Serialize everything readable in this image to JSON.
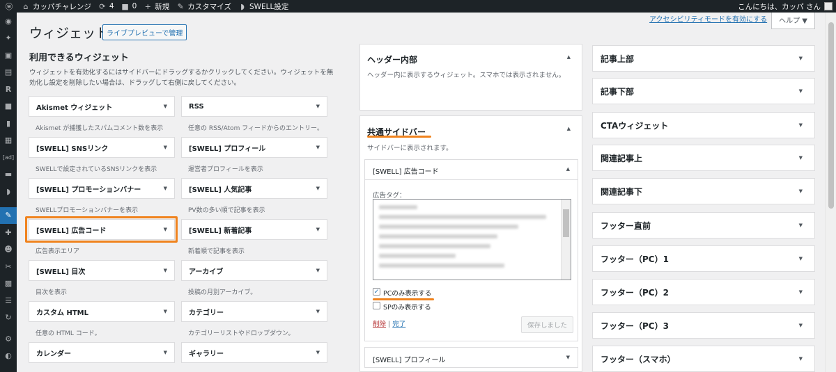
{
  "adminbar": {
    "site_name": "カッパチャレンジ",
    "updates": "4",
    "comments": "0",
    "new": "新規",
    "customize": "カスタマイズ",
    "swell": "SWELL設定",
    "greeting": "こんにちは、カッパ さん"
  },
  "menu_icons": [
    "dashboard-icon",
    "pin-icon",
    "media-icon",
    "pages-icon",
    "rank-icon",
    "comments-icon",
    "doc-icon",
    "table-icon",
    "ad-icon",
    "swell-icon",
    "chat-icon",
    "appearance-icon",
    "plugins-icon",
    "users-icon",
    "tools-icon",
    "settings-icon",
    "list-icon",
    "refresh-icon",
    "gear-icon",
    "collapse-icon"
  ],
  "menu_ad_label": "[ad]",
  "menu_r_label": "R",
  "screen_meta": {
    "a11y": "アクセシビリティモードを有効にする",
    "help": "ヘルプ ▼"
  },
  "page": {
    "title": "ウィジェット",
    "live_preview": "ライブプレビューで管理"
  },
  "available": {
    "title": "利用できるウィジェット",
    "desc": "ウィジェットを有効化するにはサイドバーにドラッグするかクリックしてください。ウィジェットを無効化し設定を削除したい場合は、ドラッグして右側に戻してください。",
    "widgets": [
      {
        "name": "Akismet ウィジェット",
        "desc": "Akismet が捕獲したスパムコメント数を表示"
      },
      {
        "name": "RSS",
        "desc": "任意の RSS/Atom フィードからのエントリー。"
      },
      {
        "name": "[SWELL] SNSリンク",
        "desc": "SWELLで設定されているSNSリンクを表示"
      },
      {
        "name": "[SWELL] プロフィール",
        "desc": "運営者プロフィールを表示"
      },
      {
        "name": "[SWELL] プロモーションバナー",
        "desc": "SWELLプロモーションバナーを表示"
      },
      {
        "name": "[SWELL] 人気記事",
        "desc": "PV数の多い順で記事を表示"
      },
      {
        "name": "[SWELL] 広告コード",
        "desc": "広告表示エリア"
      },
      {
        "name": "[SWELL] 新着記事",
        "desc": "新着順で記事を表示"
      },
      {
        "name": "[SWELL] 目次",
        "desc": "目次を表示"
      },
      {
        "name": "アーカイブ",
        "desc": "投稿の月別アーカイブ。"
      },
      {
        "name": "カスタム HTML",
        "desc": "任意の HTML コード。"
      },
      {
        "name": "カテゴリー",
        "desc": "カテゴリーリストやドロップダウン。"
      },
      {
        "name": "カレンダー",
        "desc": ""
      },
      {
        "name": "ギャラリー",
        "desc": ""
      }
    ]
  },
  "header_inner": {
    "title": "ヘッダー内部",
    "desc": "ヘッダー内に表示するウィジェット。スマホでは表示されません。"
  },
  "common_sidebar": {
    "title": "共通サイドバー",
    "desc": "サイドバーに表示されます。",
    "ad_widget": {
      "title": "[SWELL] 広告コード",
      "tag_label": "広告タグ：",
      "pc_only": "PCのみ表示する",
      "sp_only": "SPのみ表示する",
      "delete": "削除",
      "sep": "|",
      "done": "完了",
      "saved": "保存しました"
    },
    "profile_widget": "[SWELL] プロフィール"
  },
  "areas": [
    "記事上部",
    "記事下部",
    "CTAウィジェット",
    "関連記事上",
    "関連記事下",
    "フッター直前",
    "フッター（PC）1",
    "フッター（PC）2",
    "フッター（PC）3",
    "フッター（スマホ）"
  ]
}
